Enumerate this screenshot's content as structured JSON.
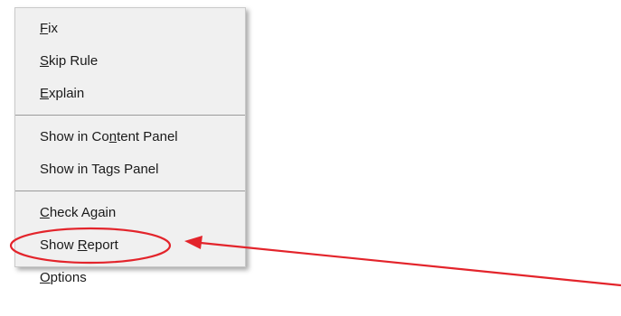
{
  "context_menu": {
    "groups": [
      [
        {
          "pre": "",
          "acc": "F",
          "post": "ix"
        },
        {
          "pre": "",
          "acc": "S",
          "post": "kip Rule"
        },
        {
          "pre": "",
          "acc": "E",
          "post": "xplain"
        }
      ],
      [
        {
          "pre": "Show in Co",
          "acc": "n",
          "post": "tent Panel"
        },
        {
          "pre": "Show in Ta",
          "acc": "g",
          "post": "s Panel"
        }
      ],
      [
        {
          "pre": "",
          "acc": "C",
          "post": "heck Again"
        },
        {
          "pre": "Show ",
          "acc": "R",
          "post": "eport"
        },
        {
          "pre": "",
          "acc": "O",
          "post": "ptions"
        }
      ]
    ]
  },
  "annotation": {
    "color": "#e3242b",
    "shape": "ellipse",
    "target": "Show Report",
    "pointer": "arrow"
  }
}
